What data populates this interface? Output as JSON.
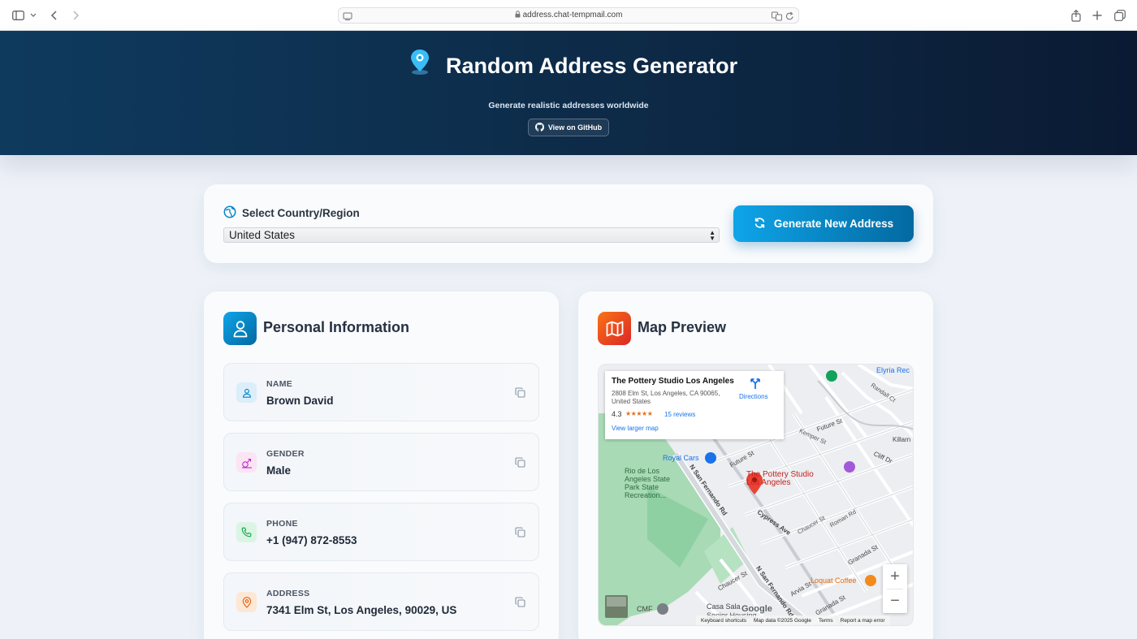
{
  "browser": {
    "url": "address.chat-tempmail.com"
  },
  "hero": {
    "title": "Random Address Generator",
    "subtitle": "Generate realistic addresses worldwide",
    "github_label": "View on GitHub"
  },
  "country": {
    "label": "Select Country/Region",
    "selected": "United States"
  },
  "generate_button": "Generate New Address",
  "personal": {
    "title": "Personal Information",
    "fields": [
      {
        "label": "NAME",
        "value": "Brown David"
      },
      {
        "label": "GENDER",
        "value": "Male"
      },
      {
        "label": "PHONE",
        "value": "+1 (947) 872-8553"
      },
      {
        "label": "ADDRESS",
        "value": "7341 Elm St, Los Angeles, 90029, US"
      }
    ]
  },
  "map": {
    "title": "Map Preview",
    "card": {
      "place_name": "The Pottery Studio Los Angeles",
      "address": "2808 Elm St, Los Angeles, CA 90065, United States",
      "rating": "4.3",
      "stars": "★★★★★",
      "reviews": "15 reviews",
      "larger_map": "View larger map",
      "directions": "Directions"
    },
    "labels": {
      "pin": "The Pottery Studio Los Angeles",
      "royal_cars": "Royal Cars",
      "park": "Rio de Los Angeles State Park State Recreation...",
      "n_san_fernando": "N San Fernando Rd",
      "n_san_fernando_2": "N San Fernando Rd",
      "future_st": "Future St",
      "future_st_2": "Future St",
      "kemper_st": "Kemper St",
      "cypress_ave": "Cypress Ave",
      "chaucer_st": "Chaucer St",
      "chaucer_st_2": "Chaucer St",
      "roman_rd": "Roman Rd",
      "granada_st": "Granada St",
      "granada_st_2": "Granada St",
      "arvia_st": "Arvia St",
      "loquat_coffee": "Loquat Coffee",
      "elyria": "Elyria Rec",
      "randall": "Randall Ct",
      "killarney": "Killarn",
      "clifford": "Cliff Dr",
      "casa": "Casa Sala",
      "senior": "Senior Housing",
      "cmf": "CMF",
      "google": "Google"
    },
    "footer": [
      "Keyboard shortcuts",
      "Map data ©2025 Google",
      "Terms",
      "Report a map error"
    ]
  },
  "colors": {
    "accent": "#0284c7",
    "map_accent": "#ea580c",
    "hero_bg": "#0d2a47"
  }
}
